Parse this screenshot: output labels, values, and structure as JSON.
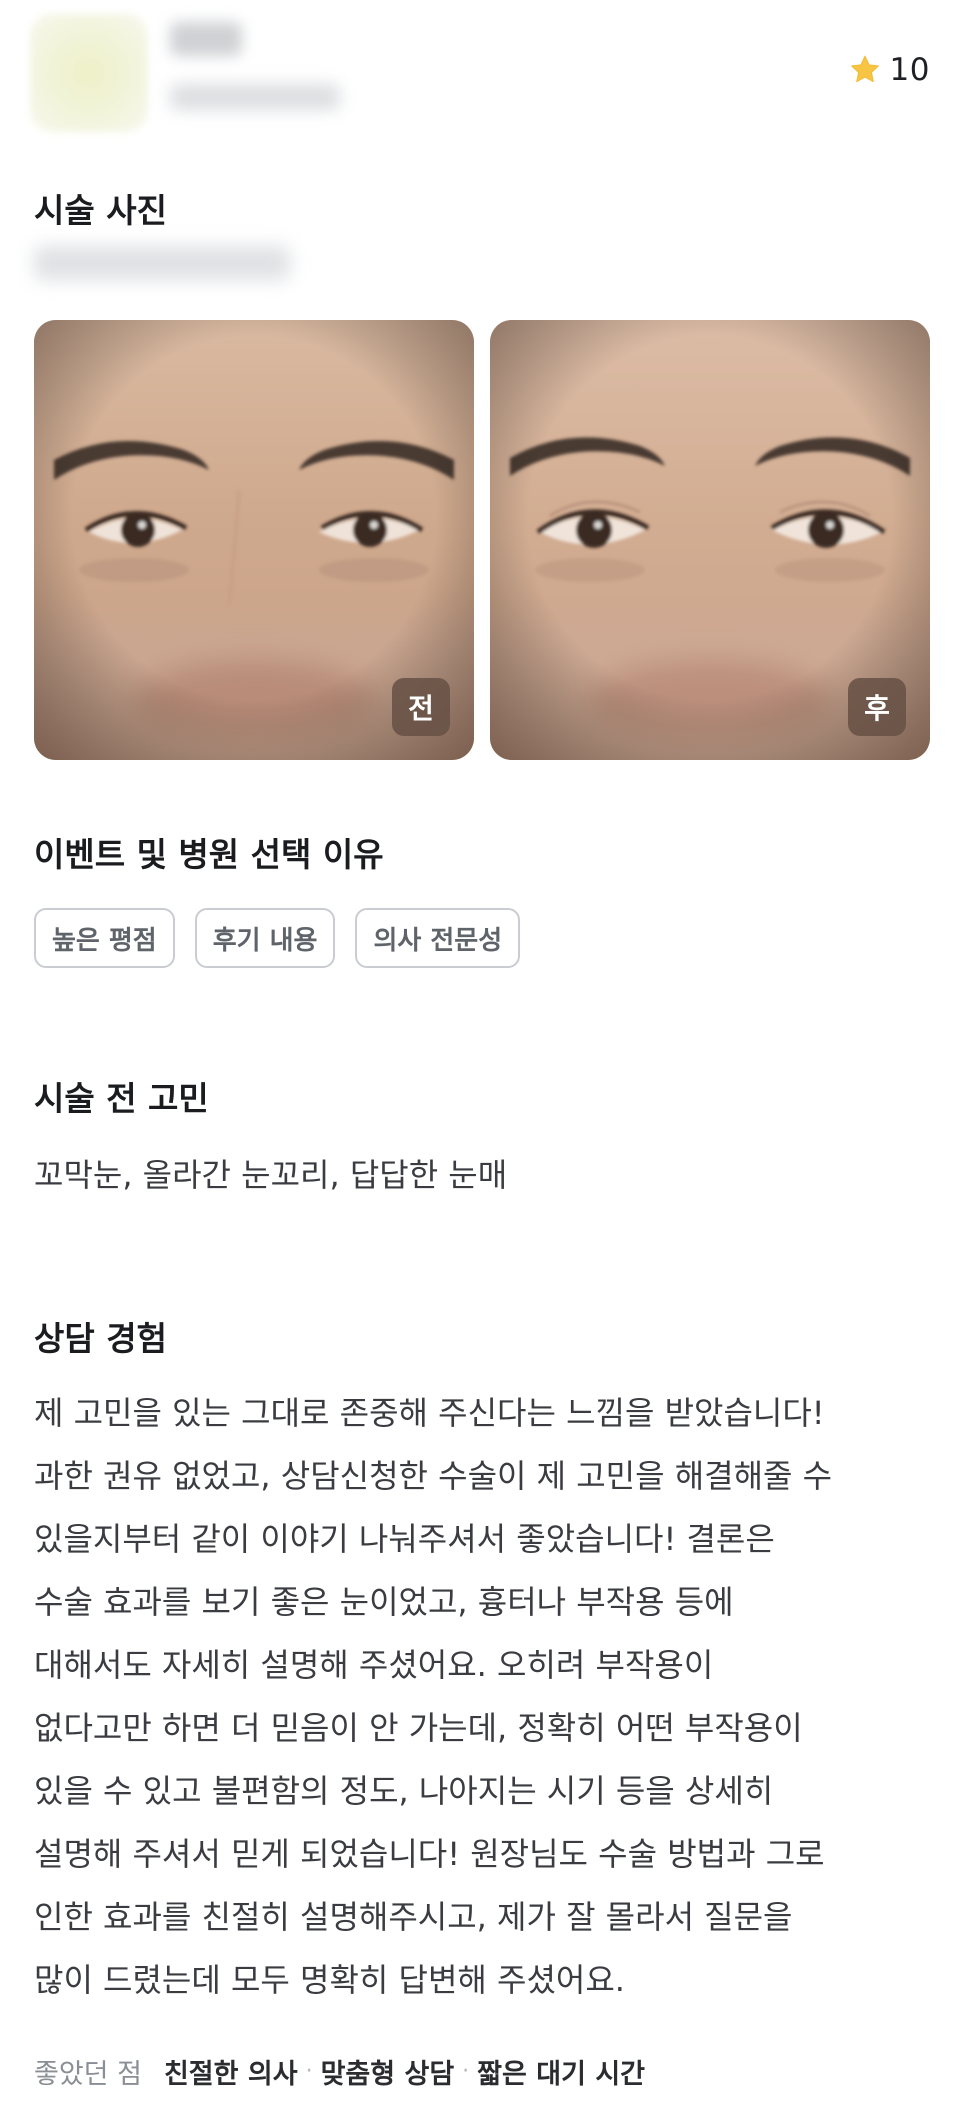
{
  "rating": {
    "icon": "star-icon",
    "score": "10",
    "star_color": "#f6c544"
  },
  "photo_section": {
    "title": "시술 사진"
  },
  "photos": [
    {
      "tag": "전"
    },
    {
      "tag": "후"
    }
  ],
  "reason_section": {
    "title": "이벤트 및 병원 선택 이유",
    "chips": [
      "높은 평점",
      "후기 내용",
      "의사 전문성"
    ]
  },
  "concern_section": {
    "title": "시술 전 고민",
    "text": "꼬막눈, 올라간 눈꼬리, 답답한 눈매"
  },
  "consult_section": {
    "title": "상담 경험",
    "lines": [
      "제 고민을 있는 그대로 존중해 주신다는 느낌을 받았습니다!",
      "과한 권유 없었고, 상담신청한 수술이 제 고민을 해결해줄 수",
      "있을지부터 같이 이야기 나눠주셔서 좋았습니다! 결론은",
      "수술 효과를 보기 좋은 눈이었고, 흉터나 부작용 등에",
      "대해서도 자세히 설명해 주셨어요. 오히려 부작용이",
      "없다고만 하면 더 믿음이 안 가는데, 정확히 어떤 부작용이",
      "있을 수 있고 불편함의 정도, 나아지는 시기 등을 상세히",
      "설명해 주셔서 믿게 되었습니다! 원장님도 수술 방법과 그로",
      "인한 효과를 친절히 설명해주시고, 제가 잘 몰라서 질문을",
      "많이 드렸는데 모두 명확히 답변해 주셨어요."
    ]
  },
  "liked": {
    "label": "좋았던 점",
    "items": [
      "친절한 의사",
      "맞춤형 상담",
      "짧은 대기 시간"
    ],
    "separator": "·"
  }
}
